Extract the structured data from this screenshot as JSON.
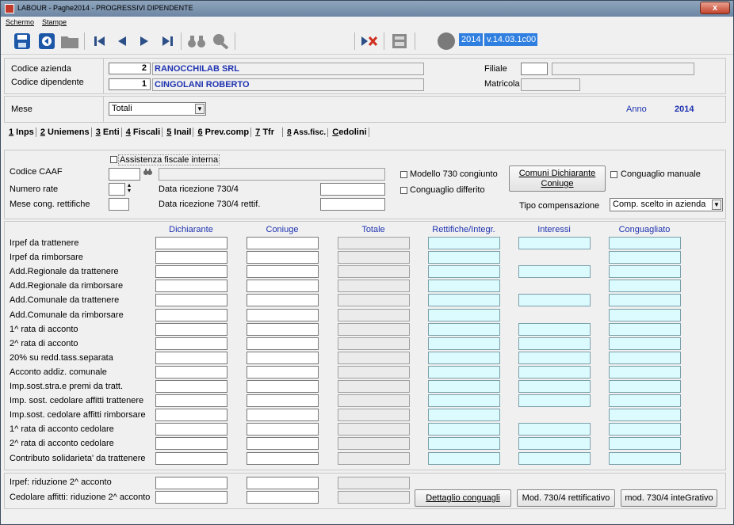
{
  "window": {
    "title": "LABOUR - Paghe2014 - PROGRESSIVI DIPENDENTE",
    "close_label": "x"
  },
  "menu": [
    "Schermo",
    "Stampe"
  ],
  "toolbar": {
    "icons": [
      "save-icon",
      "back-icon",
      "folder-icon",
      "first-icon",
      "prev-icon",
      "next-icon",
      "last-icon",
      "binoculars-icon",
      "magnifier-icon",
      "delete-icon",
      "calculator-icon"
    ],
    "year": "2014",
    "version": "v.14.03.1c00"
  },
  "header": {
    "azienda_label": "Codice azienda",
    "azienda_code": "2",
    "azienda_name": "RANOCCHILAB SRL",
    "dipendente_label": "Codice dipendente",
    "dipendente_code": "1",
    "dipendente_name": "CINGOLANI ROBERTO",
    "filiale_label": "Filiale",
    "matricola_label": "Matricola"
  },
  "period": {
    "mese_label": "Mese",
    "mese_value": "Totali",
    "anno_label": "Anno",
    "anno_value": "2014"
  },
  "tabs": [
    {
      "num": "1",
      "label": " Inps"
    },
    {
      "num": "2",
      "label": " Uniemens"
    },
    {
      "num": "3",
      "label": " Enti"
    },
    {
      "num": "4",
      "label": " Fiscali"
    },
    {
      "num": "5",
      "label": " Inail"
    },
    {
      "num": "6",
      "label": " Prev.comp"
    },
    {
      "num": "7",
      "label": " Tfr"
    },
    {
      "num": "8",
      "label": " Ass.fisc."
    },
    {
      "num": "C",
      "label": "edolini"
    }
  ],
  "form": {
    "assistenza_label": "Assistenza fiscale interna",
    "caaf_label": "Codice CAAF",
    "numero_rate_label": "Numero rate",
    "mese_cong_label": "Mese cong. rettifiche",
    "data_ric_label": "Data ricezione 730/4",
    "data_ric_rett_label": "Data ricezione 730/4 rettif.",
    "modello_congiunto_label": "Modello 730 congiunto",
    "conguaglio_differito_label": "Conguaglio differito",
    "comuni_button": "Comuni Dichiarante Coniuge",
    "conguaglio_manuale_label": "Conguaglio manuale",
    "tipo_comp_label": "Tipo compensazione",
    "tipo_comp_value": "Comp. scelto in azienda"
  },
  "grid": {
    "columns": [
      "Dichiarante",
      "Coniuge",
      "Totale",
      "Rettifiche/Integr.",
      "Interessi",
      "Conguagliato"
    ],
    "rows": [
      {
        "label": "Irpef da trattenere",
        "interessi": true
      },
      {
        "label": "Irpef da rimborsare",
        "interessi": false
      },
      {
        "label": "Add.Regionale da trattenere",
        "interessi": true
      },
      {
        "label": "Add.Regionale da rimborsare",
        "interessi": false
      },
      {
        "label": "Add.Comunale da trattenere",
        "interessi": true
      },
      {
        "label": "Add.Comunale da rimborsare",
        "interessi": false
      },
      {
        "label": "1^ rata di acconto",
        "interessi": true
      },
      {
        "label": "2^ rata di acconto",
        "interessi": true
      },
      {
        "label": "20% su redd.tass.separata",
        "interessi": true
      },
      {
        "label": "Acconto addiz. comunale",
        "interessi": true
      },
      {
        "label": "Imp.sost.stra.e premi da tratt.",
        "interessi": true
      },
      {
        "label": "Imp. sost. cedolare affitti trattenere",
        "interessi": true
      },
      {
        "label": "Imp.sost. cedolare affitti rimborsare",
        "interessi": false
      },
      {
        "label": "1^ rata di acconto cedolare",
        "interessi": true
      },
      {
        "label": "2^ rata di acconto cedolare",
        "interessi": true
      },
      {
        "label": "Contributo solidarieta' da trattenere",
        "interessi": true
      }
    ]
  },
  "bottom": {
    "irpef_riduzione_label": "Irpef: riduzione 2^ acconto",
    "cedolare_riduzione_label": "Cedolare affitti: riduzione 2^ acconto",
    "dettaglio_button": "Dettaglio conguagli",
    "mod_rettificativo_button": "Mod. 730/4 rettificativo",
    "mod_integrativo_button": "mod. 730/4 inteGrativo"
  },
  "colors": {
    "accent_blue": "#1f33b0",
    "highlight_cell": "#dcfbff",
    "chip_blue": "#2f7fe0"
  }
}
